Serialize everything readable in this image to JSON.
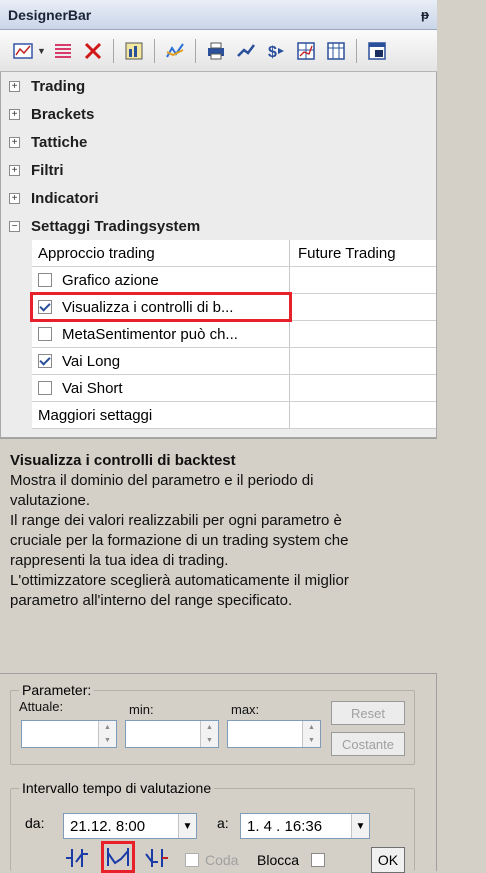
{
  "window": {
    "title": "DesignerBar",
    "pin_glyph": "ᵽ"
  },
  "toolbar": {
    "icons": [
      "chart-icon",
      "dropdown-arrow-icon",
      "list-icon",
      "delete-icon",
      "column-chart-icon",
      "line-chart-icon",
      "printer-icon",
      "trend-icon",
      "dollar-icon",
      "grid-chart-icon",
      "table-icon",
      "window-icon"
    ]
  },
  "categories": [
    {
      "label": "Trading",
      "expander": "+"
    },
    {
      "label": "Brackets",
      "expander": "+"
    },
    {
      "label": "Tattiche",
      "expander": "+"
    },
    {
      "label": "Filtri",
      "expander": "+"
    },
    {
      "label": "Indicatori",
      "expander": "+"
    },
    {
      "label": "Settaggi Tradingsystem",
      "expander": "−"
    }
  ],
  "properties": [
    {
      "name": "Approccio trading",
      "value": "Future Trading",
      "checkbox": null
    },
    {
      "name": "Grafico azione",
      "value": "",
      "checkbox": false
    },
    {
      "name": "Visualizza i controlli di b...",
      "value": "",
      "checkbox": true,
      "highlighted": true
    },
    {
      "name": "MetaSentimentor può ch...",
      "value": "",
      "checkbox": false
    },
    {
      "name": "Vai Long",
      "value": "",
      "checkbox": true
    },
    {
      "name": "Vai Short",
      "value": "",
      "checkbox": false
    },
    {
      "name": "Maggiori settaggi",
      "value": "",
      "checkbox": null
    }
  ],
  "description": {
    "title": "Visualizza i controlli di backtest",
    "body": "Mostra il dominio del parametro e il periodo di\nvalutazione.\nIl range dei valori realizzabili per ogni parametro è\ncruciale per la formazione di un trading system che\nrappresenti la tua idea di trading.\nL'ottimizzatore sceglierà automaticamente il miglior\nparametro all'interno del range specificato."
  },
  "parameter": {
    "legend": "Parameter:",
    "actual_label": "Attuale:",
    "min_label": "min:",
    "max_label": "max:",
    "reset_label": "Reset",
    "constant_label": "Costante"
  },
  "interval": {
    "legend": "Intervallo tempo di valutazione",
    "from_label": "da:",
    "from_value": "21.12.  8:00",
    "to_label": "a:",
    "to_value": "1. 4 . 16:36",
    "tail_label": "Coda",
    "block_label": "Blocca",
    "ok_label": "OK"
  },
  "colors": {
    "highlight": "#e8202a",
    "accent": "#2a4f9b"
  }
}
